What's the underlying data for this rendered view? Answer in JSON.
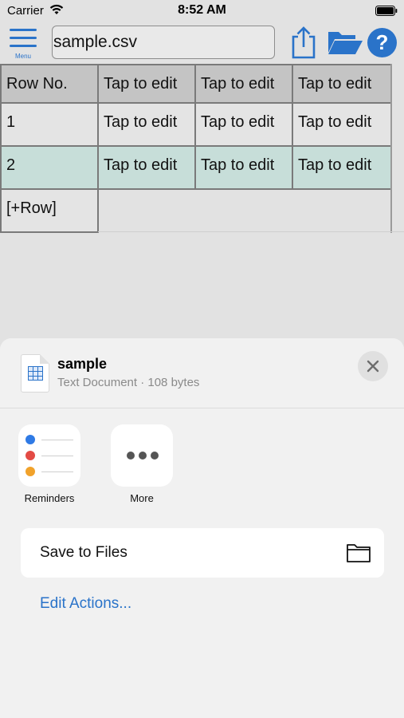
{
  "status_bar": {
    "carrier": "Carrier",
    "time": "8:52 AM"
  },
  "toolbar": {
    "menu_label": "Menu",
    "filename": "sample.csv",
    "help_label": "?"
  },
  "table": {
    "headers": [
      "Row No.",
      "Tap to edit",
      "Tap to edit",
      "Tap to edit"
    ],
    "rows": [
      [
        "1",
        "Tap to edit",
        "Tap to edit",
        "Tap to edit"
      ],
      [
        "2",
        "Tap to edit",
        "Tap to edit",
        "Tap to edit"
      ]
    ],
    "add_row_label": "[+Row]"
  },
  "share_sheet": {
    "doc_title": "sample",
    "doc_subtitle": "Text Document · 108 bytes",
    "apps": [
      {
        "label": "Reminders",
        "icon": "reminders-icon"
      },
      {
        "label": "More",
        "icon": "more-icon"
      }
    ],
    "save_to_files": "Save to Files",
    "edit_actions": "Edit Actions..."
  },
  "colors": {
    "accent": "#2a73c9",
    "header_bg": "#c4c4c4",
    "row_bg": "#e4e4e4",
    "selected_row_bg": "#c7ded9",
    "reminder_blue": "#2f7ae5",
    "reminder_red": "#e34b45",
    "reminder_orange": "#f1a22b"
  }
}
